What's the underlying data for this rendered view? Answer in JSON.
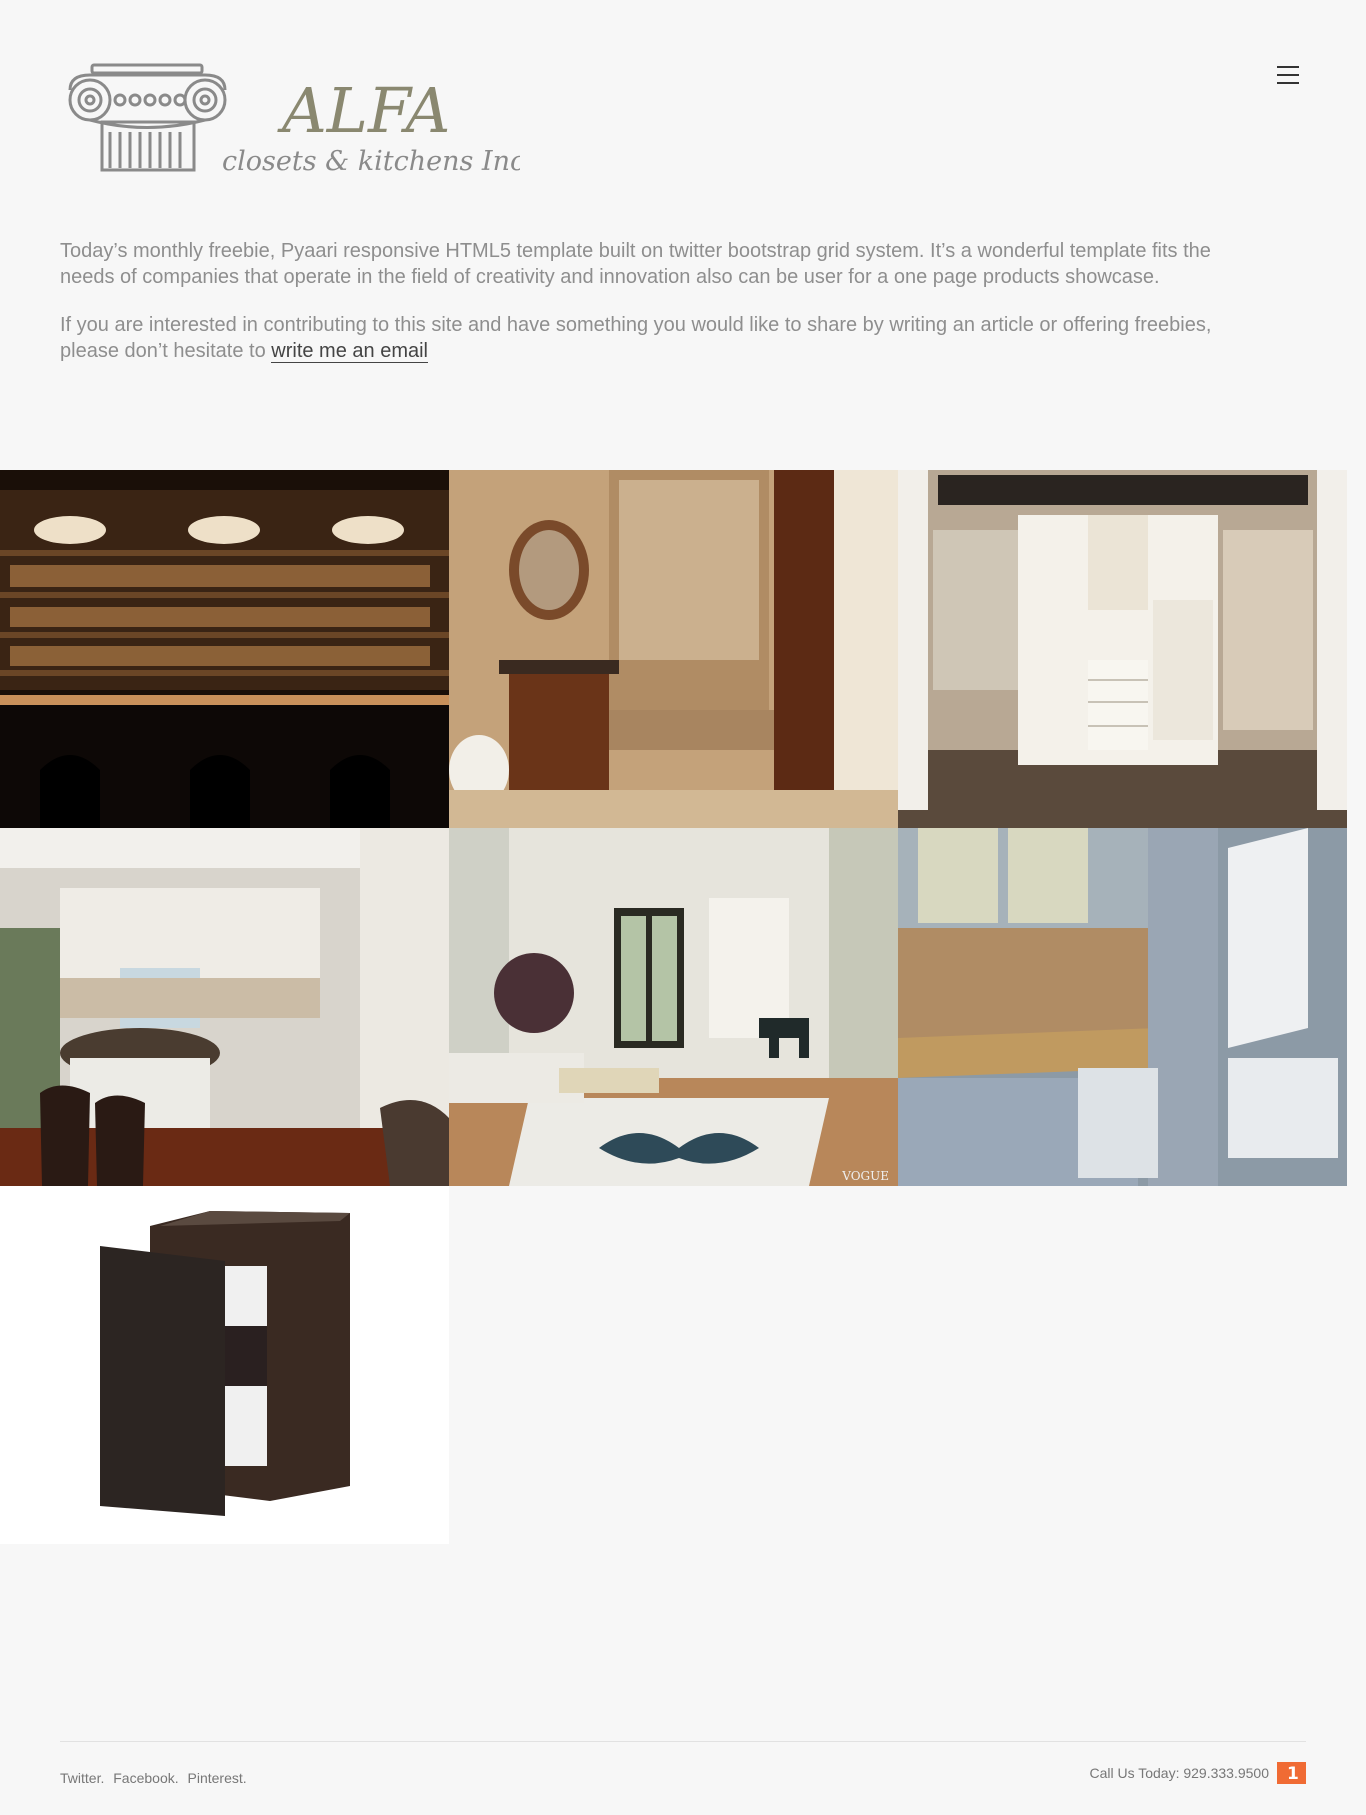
{
  "brand": {
    "name": "ALFA",
    "tagline": "closets & kitchens Inc."
  },
  "nav": {
    "menu_icon": "hamburger-icon"
  },
  "intro": {
    "paragraph1": "Today’s monthly freebie, Pyaari responsive HTML5 template built on twitter bootstrap grid system. It’s a wonderful template fits the needs of companies that operate in the field of creativity and innovation also can be user for a one page products showcase.",
    "paragraph2_prefix": "If you are interested in contributing to this site and have something you would like to share by writing an article or offering freebies, please don’t hesitate to ",
    "email_link": "write me an email"
  },
  "gallery": {
    "watermark": "VOGUE"
  },
  "footer": {
    "social": [
      "Twitter.",
      "Facebook.",
      "Pinterest."
    ],
    "call": "Call Us Today: 929.333.9500",
    "badge_icon": "one-badge-icon",
    "badge_text": "1"
  },
  "colors": {
    "background": "#f7f7f7",
    "logo": "#8a8870",
    "badge": "#f06b34"
  }
}
